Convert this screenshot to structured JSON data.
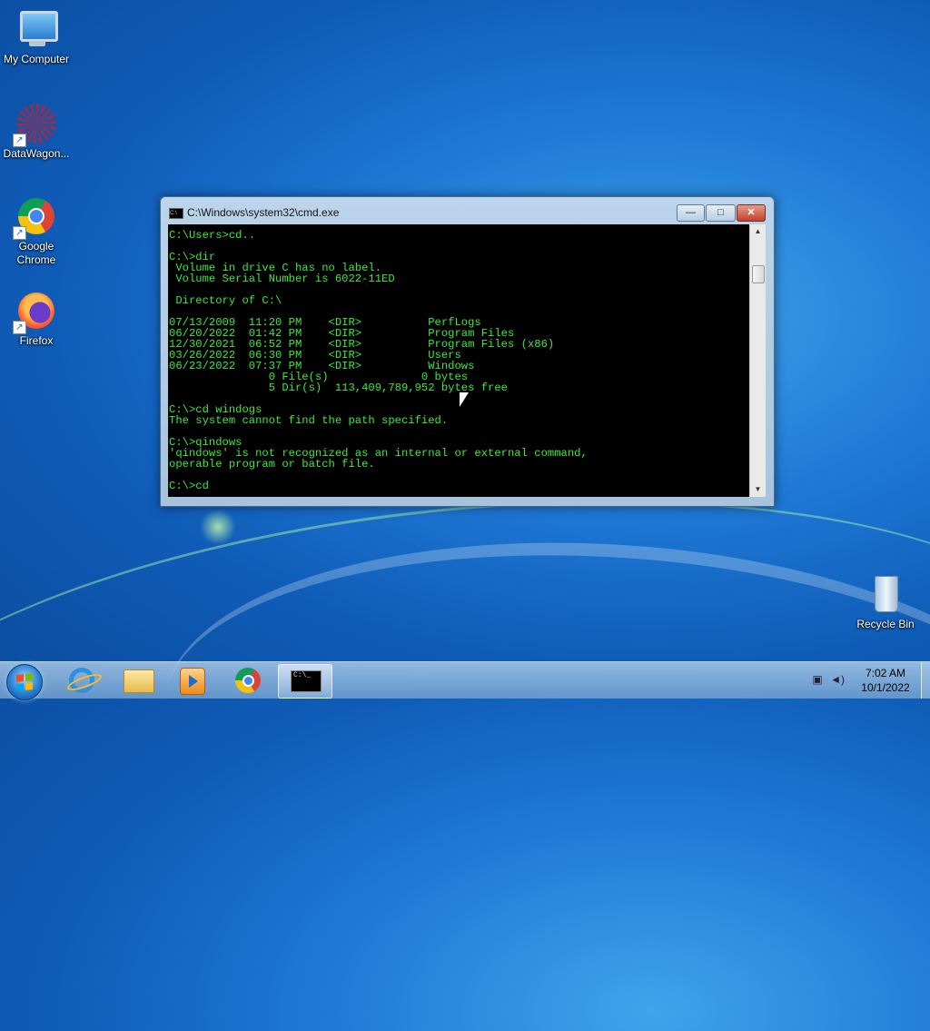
{
  "desktop": {
    "icons": [
      {
        "label": "My Computer",
        "icon": "computer-icon"
      },
      {
        "label": "DataWagon...",
        "icon": "datawagon-icon"
      },
      {
        "label": "Google Chrome",
        "icon": "chrome-icon"
      },
      {
        "label": "Firefox",
        "icon": "firefox-icon"
      },
      {
        "label": "Recycle Bin",
        "icon": "recycle-bin-icon"
      }
    ]
  },
  "cmd_window": {
    "title": "C:\\Windows\\system32\\cmd.exe",
    "console_output": "C:\\Users>cd..\n\nC:\\>dir\n Volume in drive C has no label.\n Volume Serial Number is 6022-11ED\n\n Directory of C:\\\n\n07/13/2009  11:20 PM    <DIR>          PerfLogs\n06/20/2022  01:42 PM    <DIR>          Program Files\n12/30/2021  06:52 PM    <DIR>          Program Files (x86)\n03/26/2022  06:30 PM    <DIR>          Users\n06/23/2022  07:37 PM    <DIR>          Windows\n               0 File(s)              0 bytes\n               5 Dir(s)  113,409,789,952 bytes free\n\nC:\\>cd windogs\nThe system cannot find the path specified.\n\nC:\\>qindows\n'qindows' is not recognized as an internal or external command,\noperable program or batch file.\n\nC:\\>cd",
    "buttons": {
      "minimize": "—",
      "maximize": "□",
      "close": "✕"
    }
  },
  "taskbar": {
    "items": [
      "internet-explorer-icon",
      "windows-explorer-icon",
      "media-player-icon",
      "chrome-icon",
      "cmd-icon"
    ],
    "cmd_label": "C:\\_",
    "clock": {
      "time": "7:02 AM",
      "date": "10/1/2022"
    }
  },
  "colors": {
    "console_text": "#3ee83a",
    "console_bg": "#000000"
  }
}
